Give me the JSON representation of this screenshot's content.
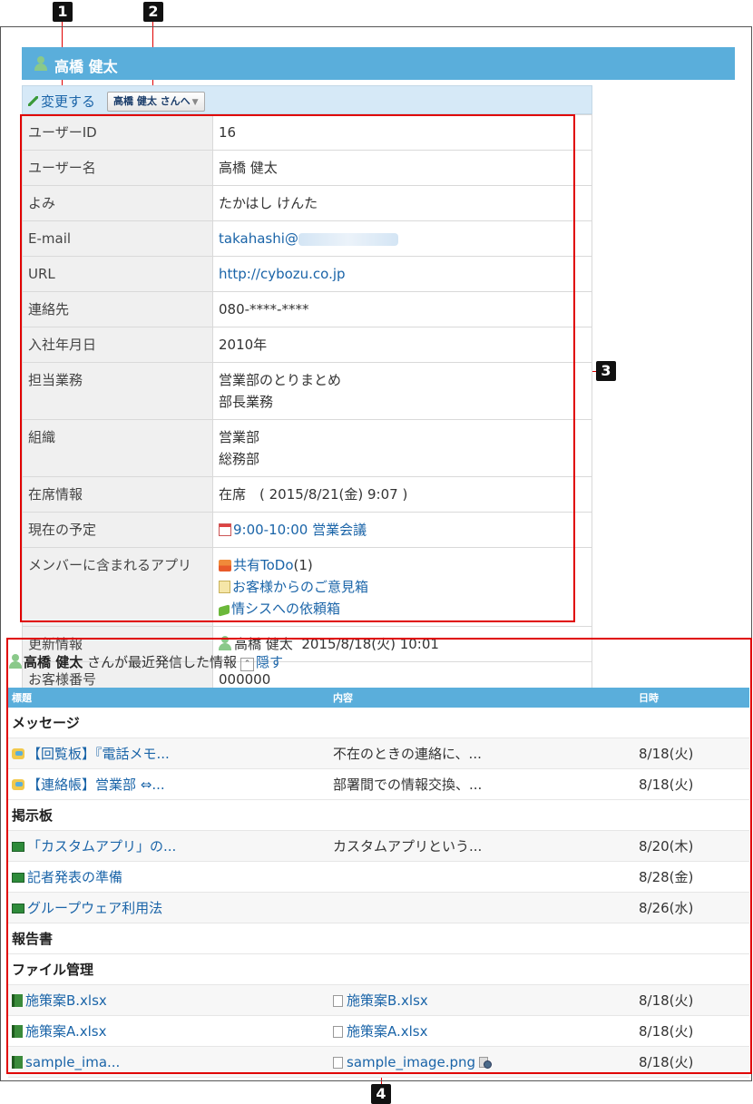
{
  "callouts": [
    "1",
    "2",
    "3",
    "4"
  ],
  "user": {
    "name": "高橋 健太"
  },
  "actions": {
    "edit_label": "変更する",
    "user_menu_label": "高橋 健太 さんへ"
  },
  "profile": {
    "rows": [
      {
        "key": "ユーザーID",
        "value": "16"
      },
      {
        "key": "ユーザー名",
        "value": "高橋 健太"
      },
      {
        "key": "よみ",
        "value": "たかはし けんた"
      },
      {
        "key": "E-mail",
        "value": "takahashi@"
      },
      {
        "key": "URL",
        "value": "http://cybozu.co.jp"
      },
      {
        "key": "連絡先",
        "value": "080-****-****"
      },
      {
        "key": "入社年月日",
        "value": "2010年"
      },
      {
        "key": "担当業務",
        "lines": [
          "営業部のとりまとめ",
          "部長業務"
        ]
      },
      {
        "key": "組織",
        "lines": [
          "営業部",
          "総務部"
        ]
      },
      {
        "key": "在席情報",
        "value": "在席　( 2015/8/21(金) 9:07 )"
      },
      {
        "key": "現在の予定",
        "value": "9:00-10:00 営業会議"
      },
      {
        "key": "メンバーに含まれるアプリ",
        "apps": [
          "共有ToDo",
          "(1)",
          "お客様からのご意見箱",
          "情シスへの依頼箱"
        ]
      },
      {
        "key": "更新情報",
        "user": "高橋 健太",
        "date": "2015/8/18(火) 10:01"
      },
      {
        "key": "お客様番号",
        "value": "000000"
      }
    ]
  },
  "recent": {
    "user": "高橋 健太",
    "suffix": "さんが最近発信した情報",
    "hide_label": "隠す",
    "columns": [
      "標題",
      "内容",
      "日時"
    ],
    "sections": [
      {
        "title": "メッセージ",
        "rows": [
          {
            "title": "【回覧板】『電話メモ...",
            "content": "不在のときの連絡に、...",
            "date": "8/18(火)"
          },
          {
            "title": "【連絡帳】営業部 ⇔...",
            "content": "部署間での情報交換、...",
            "date": "8/18(火)"
          }
        ]
      },
      {
        "title": "掲示板",
        "rows": [
          {
            "title": "「カスタムアプリ」の...",
            "content": "カスタムアプリという...",
            "date": "8/20(木)"
          },
          {
            "title": "記者発表の準備",
            "content": "",
            "date": "8/28(金)"
          },
          {
            "title": "グループウェア利用法",
            "content": "",
            "date": "8/26(水)"
          }
        ]
      },
      {
        "title": "報告書",
        "rows": []
      },
      {
        "title": "ファイル管理",
        "rows": [
          {
            "title": "施策案B.xlsx",
            "content": "施策案B.xlsx",
            "date": "8/18(火)"
          },
          {
            "title": "施策案A.xlsx",
            "content": "施策案A.xlsx",
            "date": "8/18(火)"
          },
          {
            "title": "sample_ima...",
            "content": "sample_image.png",
            "date": "8/18(火)"
          }
        ]
      }
    ]
  }
}
